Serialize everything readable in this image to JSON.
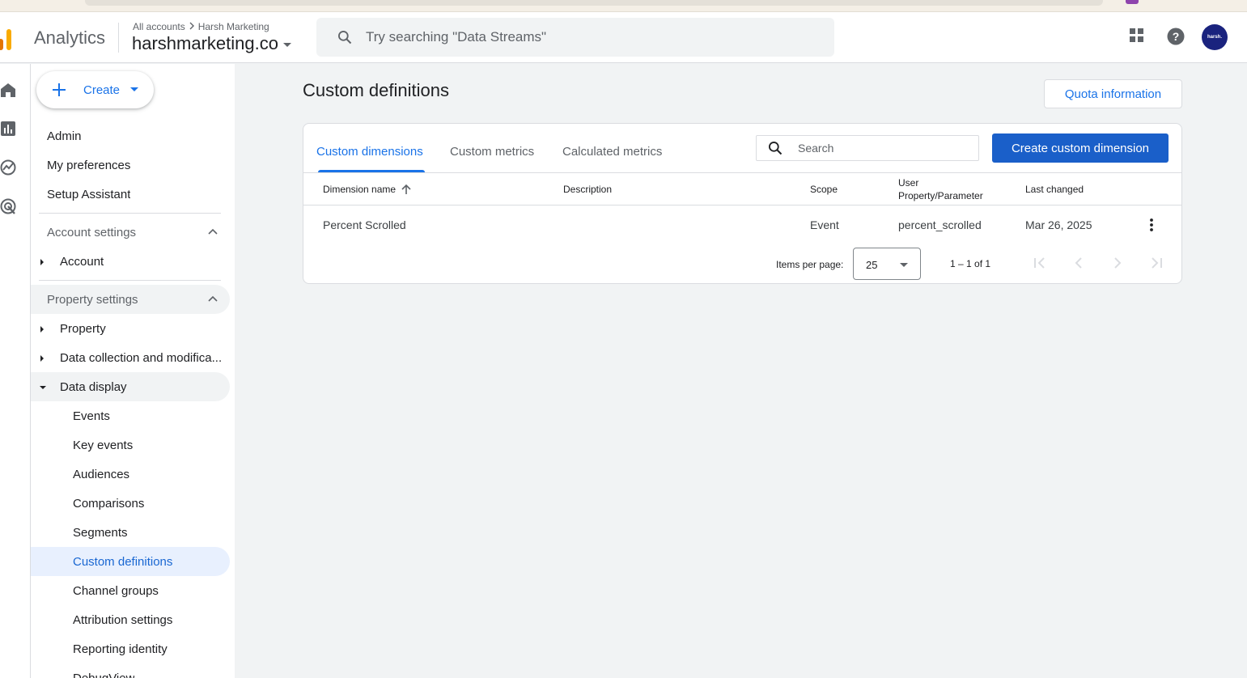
{
  "header": {
    "app_name": "Analytics",
    "breadcrumb_root": "All accounts",
    "breadcrumb_account": "Harsh Marketing",
    "property_name": "harshmarketing.co",
    "search_placeholder": "Try searching \"Data Streams\"",
    "avatar_text": "harsh."
  },
  "sidebar": {
    "create_label": "Create",
    "items": {
      "admin": "Admin",
      "my_preferences": "My preferences",
      "setup_assistant": "Setup Assistant",
      "account_settings": "Account settings",
      "account": "Account",
      "property_settings": "Property settings",
      "property": "Property",
      "data_collection": "Data collection and modifica...",
      "data_display": "Data display",
      "events": "Events",
      "key_events": "Key events",
      "audiences": "Audiences",
      "comparisons": "Comparisons",
      "segments": "Segments",
      "custom_definitions": "Custom definitions",
      "channel_groups": "Channel groups",
      "attribution_settings": "Attribution settings",
      "reporting_identity": "Reporting identity",
      "debugview": "DebugView"
    }
  },
  "main": {
    "title": "Custom definitions",
    "quota_button": "Quota information",
    "tabs": [
      "Custom dimensions",
      "Custom metrics",
      "Calculated metrics"
    ],
    "search_placeholder": "Search",
    "create_button": "Create custom dimension",
    "columns": {
      "name": "Dimension name",
      "description": "Description",
      "scope": "Scope",
      "user_property_l1": "User",
      "user_property_l2": "Property/Parameter",
      "last_changed": "Last changed"
    },
    "rows": [
      {
        "name": "Percent Scrolled",
        "description": "",
        "scope": "Event",
        "parameter": "percent_scrolled",
        "last_changed": "Mar 26, 2025"
      }
    ],
    "pagination": {
      "items_per_page_label": "Items per page:",
      "items_per_page": "25",
      "range": "1 – 1 of 1"
    }
  },
  "colors": {
    "brand_orange": "#f9ab00",
    "brand_orange_dark": "#e37400",
    "accent_blue": "#1a73e8",
    "primary_button": "#1a5fc9"
  }
}
